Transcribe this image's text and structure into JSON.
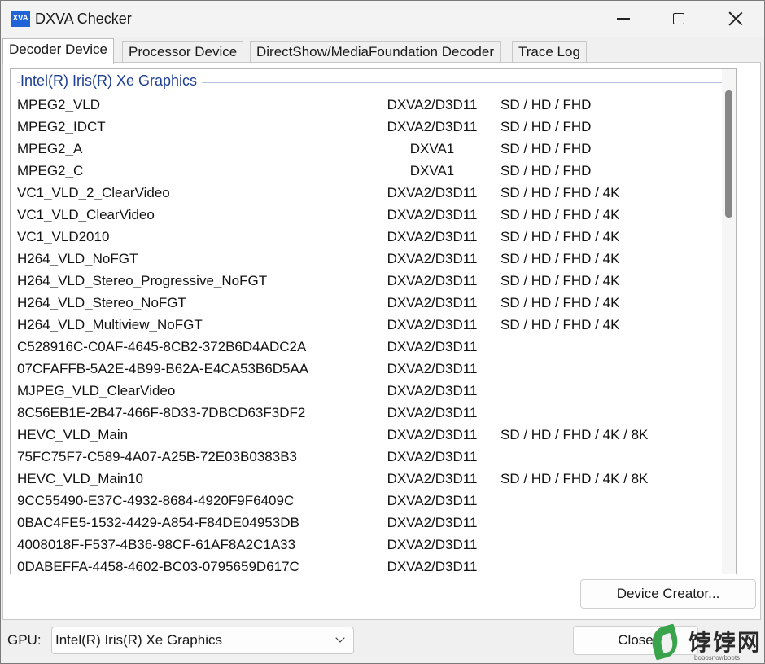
{
  "window": {
    "icon_text": "XVA",
    "title": "DXVA Checker"
  },
  "tabs": [
    {
      "label": "Decoder Device"
    },
    {
      "label": "Processor Device"
    },
    {
      "label": "DirectShow/MediaFoundation Decoder"
    },
    {
      "label": "Trace Log"
    }
  ],
  "group_header": "Intel(R) Iris(R) Xe Graphics",
  "decoders": [
    {
      "name": "MPEG2_VLD",
      "api": "DXVA2/D3D11",
      "res": "SD / HD / FHD"
    },
    {
      "name": "MPEG2_IDCT",
      "api": "DXVA2/D3D11",
      "res": "SD / HD / FHD"
    },
    {
      "name": "MPEG2_A",
      "api": "DXVA1",
      "res": "SD / HD / FHD"
    },
    {
      "name": "MPEG2_C",
      "api": "DXVA1",
      "res": "SD / HD / FHD"
    },
    {
      "name": "VC1_VLD_2_ClearVideo",
      "api": "DXVA2/D3D11",
      "res": "SD / HD / FHD / 4K"
    },
    {
      "name": "VC1_VLD_ClearVideo",
      "api": "DXVA2/D3D11",
      "res": "SD / HD / FHD / 4K"
    },
    {
      "name": "VC1_VLD2010",
      "api": "DXVA2/D3D11",
      "res": "SD / HD / FHD / 4K"
    },
    {
      "name": "H264_VLD_NoFGT",
      "api": "DXVA2/D3D11",
      "res": "SD / HD / FHD / 4K"
    },
    {
      "name": "H264_VLD_Stereo_Progressive_NoFGT",
      "api": "DXVA2/D3D11",
      "res": "SD / HD / FHD / 4K"
    },
    {
      "name": "H264_VLD_Stereo_NoFGT",
      "api": "DXVA2/D3D11",
      "res": "SD / HD / FHD / 4K"
    },
    {
      "name": "H264_VLD_Multiview_NoFGT",
      "api": "DXVA2/D3D11",
      "res": "SD / HD / FHD / 4K"
    },
    {
      "name": "C528916C-C0AF-4645-8CB2-372B6D4ADC2A",
      "api": "DXVA2/D3D11",
      "res": ""
    },
    {
      "name": "07CFAFFB-5A2E-4B99-B62A-E4CA53B6D5AA",
      "api": "DXVA2/D3D11",
      "res": ""
    },
    {
      "name": "MJPEG_VLD_ClearVideo",
      "api": "DXVA2/D3D11",
      "res": ""
    },
    {
      "name": "8C56EB1E-2B47-466F-8D33-7DBCD63F3DF2",
      "api": "DXVA2/D3D11",
      "res": ""
    },
    {
      "name": "HEVC_VLD_Main",
      "api": "DXVA2/D3D11",
      "res": "SD / HD / FHD / 4K / 8K"
    },
    {
      "name": "75FC75F7-C589-4A07-A25B-72E03B0383B3",
      "api": "DXVA2/D3D11",
      "res": ""
    },
    {
      "name": "HEVC_VLD_Main10",
      "api": "DXVA2/D3D11",
      "res": "SD / HD / FHD / 4K / 8K"
    },
    {
      "name": "9CC55490-E37C-4932-8684-4920F9F6409C",
      "api": "DXVA2/D3D11",
      "res": ""
    },
    {
      "name": "0BAC4FE5-1532-4429-A854-F84DE04953DB",
      "api": "DXVA2/D3D11",
      "res": ""
    },
    {
      "name": "4008018F-F537-4B36-98CF-61AF8A2C1A33",
      "api": "DXVA2/D3D11",
      "res": ""
    },
    {
      "name": "0DABEFFA-4458-4602-BC03-0795659D617C",
      "api": "DXVA2/D3D11",
      "res": ""
    }
  ],
  "buttons": {
    "device_creator": "Device Creator...",
    "close": "Close"
  },
  "gpu": {
    "label": "GPU:",
    "selected": "Intel(R) Iris(R) Xe Graphics"
  },
  "watermark": {
    "text": "饽饽网",
    "sub": "bobosnowboots"
  }
}
